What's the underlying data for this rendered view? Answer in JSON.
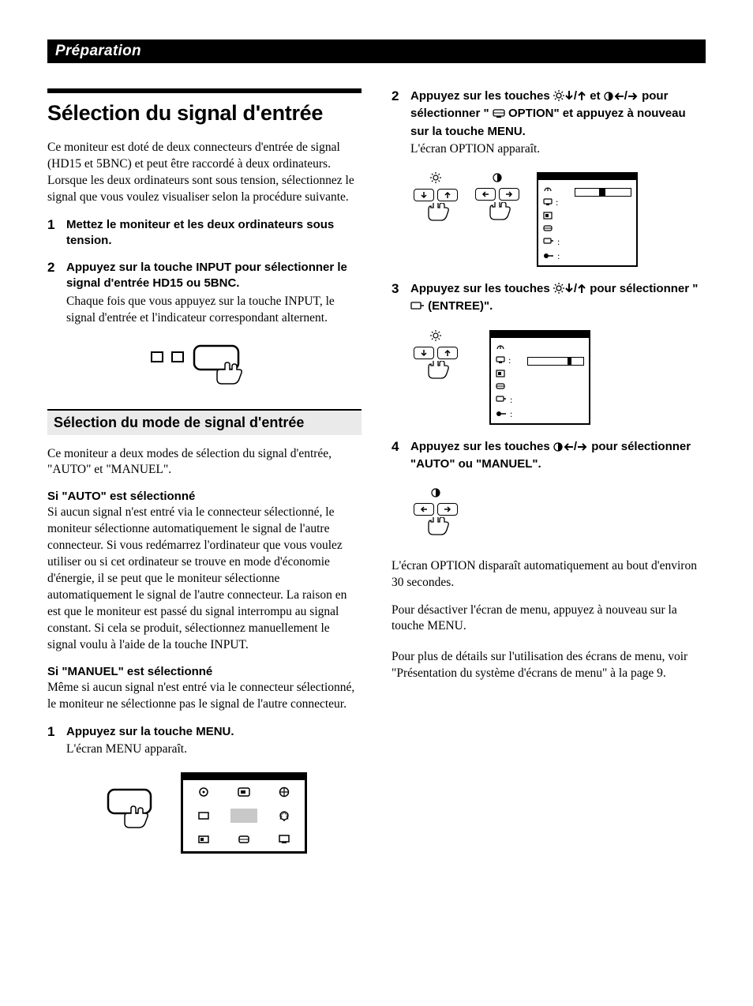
{
  "header": {
    "section": "Préparation"
  },
  "left": {
    "title": "Sélection du signal d'entrée",
    "intro": "Ce moniteur est doté de deux connecteurs d'entrée de signal (HD15 et 5BNC) et peut être raccordé à deux ordinateurs. Lorsque les deux ordinateurs sont sous tension, sélectionnez le signal que vous voulez visualiser selon la procédure suivante.",
    "step1_bold": "Mettez le moniteur et les deux ordinateurs sous tension.",
    "step2_bold": "Appuyez sur la touche INPUT pour sélectionner le signal d'entrée HD15 ou 5BNC.",
    "step2_body": "Chaque fois que vous appuyez sur la touche INPUT, le signal d'entrée et l'indicateur correspondant alternent.",
    "subheading": "Sélection du mode de signal d'entrée",
    "mode_intro": "Ce moniteur a deux modes de sélection du signal d'entrée, \"AUTO\" et \"MANUEL\".",
    "auto_title": "Si \"AUTO\" est sélectionné",
    "auto_body": "Si aucun signal n'est entré via le connecteur sélectionné, le moniteur sélectionne automatiquement le signal de l'autre connecteur. Si vous redémarrez l'ordinateur que vous voulez utiliser ou si cet ordinateur se trouve en mode d'économie d'énergie, il se peut que le moniteur sélectionne automatiquement le signal de l'autre connecteur. La raison en est que le moniteur est passé du signal interrompu au signal constant. Si cela se produit, sélectionnez manuellement le signal voulu à l'aide de la touche INPUT.",
    "manuel_title": "Si \"MANUEL\" est sélectionné",
    "manuel_body": "Même si aucun signal n'est entré via le connecteur sélectionné, le moniteur ne sélectionne pas le signal de l'autre connecteur.",
    "menu_step_bold": "Appuyez sur la touche MENU.",
    "menu_step_body": "L'écran MENU apparaît."
  },
  "right": {
    "step2_bold_a": "Appuyez sur les touches ",
    "step2_bold_mid": " et ",
    "step2_bold_b": " pour sélectionner \" ",
    "step2_bold_c": " OPTION\" et appuyez à nouveau sur la touche MENU.",
    "step2_body": "L'écran OPTION apparaît.",
    "step3_bold_a": "Appuyez sur les touches ",
    "step3_bold_b": " pour sélectionner \" ",
    "step3_bold_c": " (ENTREE)\".",
    "step4_bold_a": "Appuyez sur les touches ",
    "step4_bold_b": " pour sélectionner \"AUTO\" ou \"MANUEL\".",
    "footer1": "L'écran OPTION disparaît automatiquement au bout d'environ 30 secondes.",
    "footer2": "Pour désactiver l'écran de menu, appuyez à nouveau sur la touche MENU.",
    "footer3": "Pour plus de détails sur l'utilisation des écrans de menu, voir \"Présentation du système d'écrans de menu\" à la page 9."
  },
  "nums": {
    "n1": "1",
    "n2": "2",
    "n3": "3",
    "n4": "4"
  }
}
